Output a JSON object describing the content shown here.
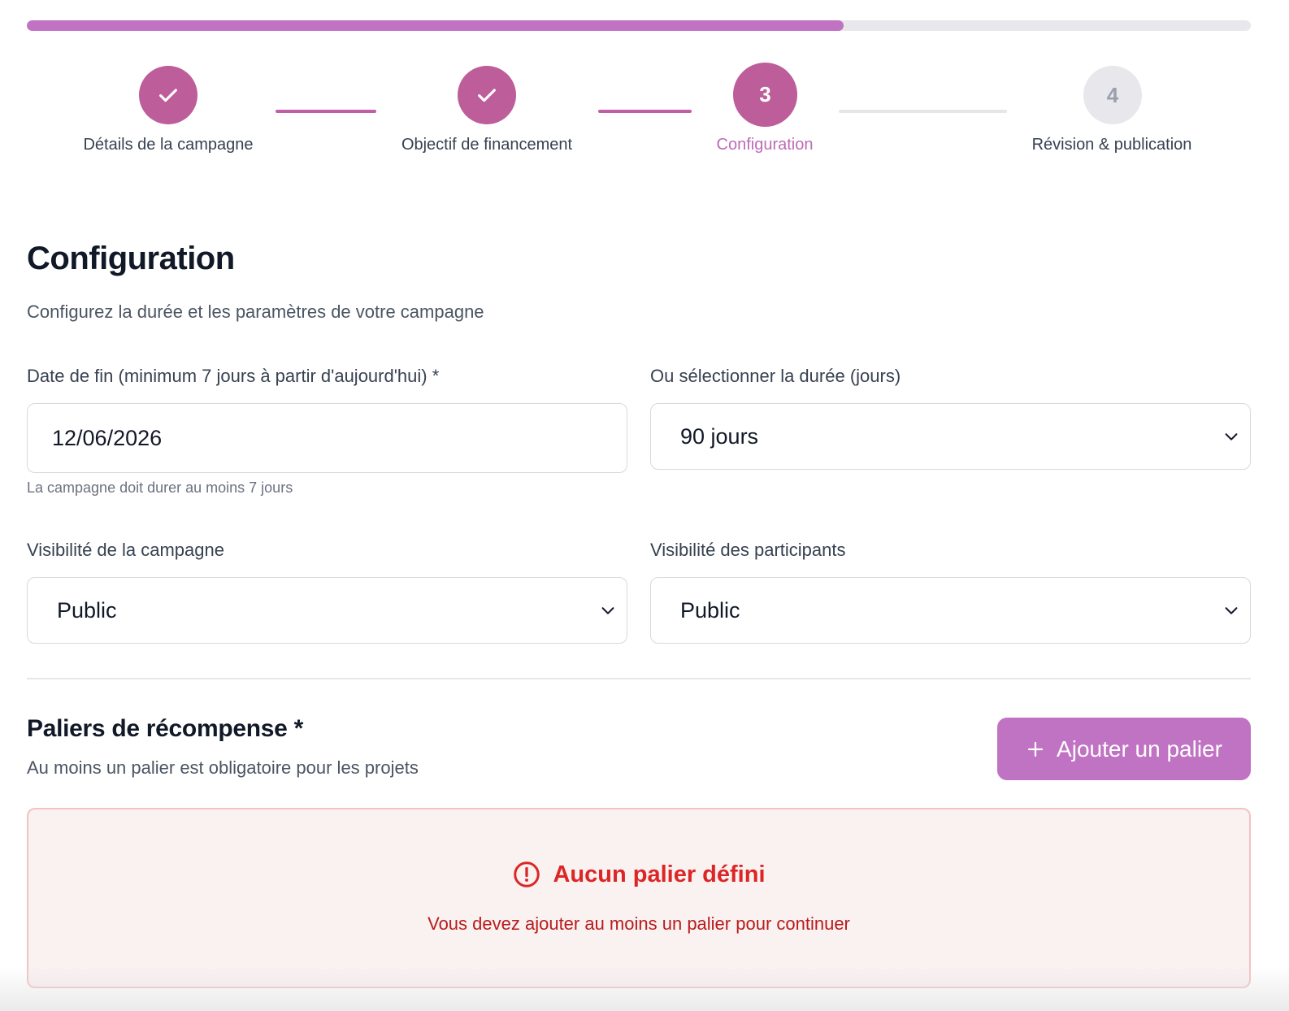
{
  "progress": {
    "fraction": 0.667
  },
  "stepper": {
    "steps": [
      {
        "state": "done",
        "marker": "",
        "label": "Détails de la campagne"
      },
      {
        "state": "done",
        "marker": "",
        "label": "Objectif de financement"
      },
      {
        "state": "current",
        "marker": "3",
        "label": "Configuration"
      },
      {
        "state": "pending",
        "marker": "4",
        "label": "Révision & publication"
      }
    ]
  },
  "header": {
    "title": "Configuration",
    "subtitle": "Configurez la durée et les paramètres de votre campagne"
  },
  "form": {
    "end_date": {
      "label": "Date de fin (minimum 7 jours à partir d'aujourd'hui) *",
      "value": "12/06/2026",
      "helper": "La campagne doit durer au moins 7 jours"
    },
    "duration": {
      "label": "Ou sélectionner la durée (jours)",
      "value": "90 jours"
    },
    "campaign_visibility": {
      "label": "Visibilité de la campagne",
      "value": "Public"
    },
    "participant_visibility": {
      "label": "Visibilité des participants",
      "value": "Public"
    }
  },
  "tiers": {
    "title": "Paliers de récompense *",
    "subtitle": "Au moins un palier est obligatoire pour les projets",
    "add_button": "Ajouter un palier",
    "empty": {
      "title": "Aucun palier défini",
      "message": "Vous devez ajouter au moins un palier pour continuer"
    }
  },
  "colors": {
    "accent": "#c173c3",
    "step_active": "#bd5d9a",
    "error": "#dc2626"
  }
}
